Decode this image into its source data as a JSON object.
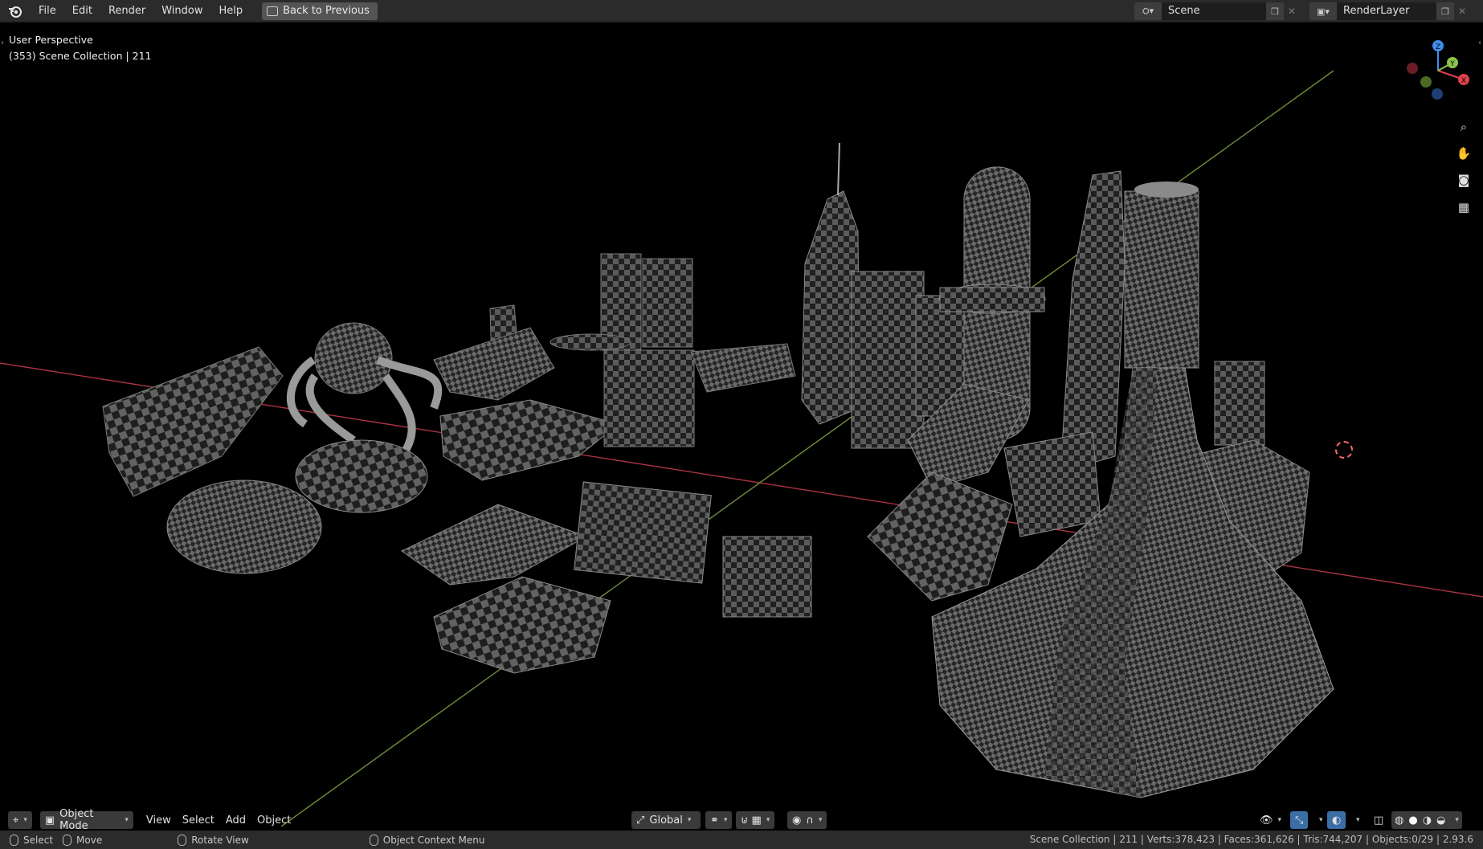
{
  "topbar": {
    "menu": [
      "File",
      "Edit",
      "Render",
      "Window",
      "Help"
    ],
    "back_label": "Back to Previous",
    "scene_name": "Scene",
    "render_layer": "RenderLayer"
  },
  "viewport": {
    "perspective_label": "User Perspective",
    "collection_label": "(353) Scene Collection | 211",
    "gizmo_axes": [
      "X",
      "Y",
      "Z"
    ]
  },
  "header": {
    "mode_label": "Object Mode",
    "menus": [
      "View",
      "Select",
      "Add",
      "Object"
    ],
    "orientation_label": "Global"
  },
  "statusbar": {
    "hint_select": "Select",
    "hint_move": "Move",
    "hint_rotate": "Rotate View",
    "hint_context": "Object Context Menu",
    "stats": "Scene Collection | 211 | Verts:378,423 | Faces:361,626 | Tris:744,207 | Objects:0/29 | 2.93.6"
  },
  "colors": {
    "x_axis": "#e0414f",
    "y_axis": "#8bc34a",
    "z_axis": "#3e8ef0",
    "header_bg": "#2b2b2b"
  }
}
